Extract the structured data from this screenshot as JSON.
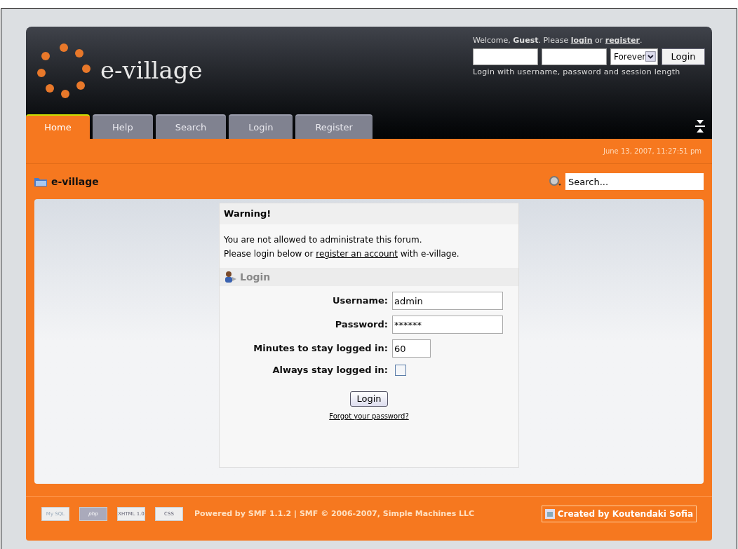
{
  "site_title": "e-village",
  "user_panel": {
    "welcome": [
      {
        "kind": "text",
        "text": "Welcome, **Guest**. Please"
      },
      {
        "kind": "link",
        "text": "login"
      },
      {
        "kind": "text",
        "text": "or"
      },
      {
        "kind": "link",
        "text": "register"
      },
      {
        "kind": "text",
        "text": "."
      }
    ],
    "session_length": "Forever",
    "button": "Login",
    "hint": "Login with username, password and session length"
  },
  "tabs": [
    {
      "label": "Home",
      "selected": true
    },
    {
      "label": "Help",
      "selected": false
    },
    {
      "label": "Search",
      "selected": false
    },
    {
      "label": "Login",
      "selected": false
    },
    {
      "label": "Register",
      "selected": false
    }
  ],
  "date": "June 13, 2007, 11:27:51 pm",
  "breadcrumb": "e-village",
  "search": {
    "placeholder": "Search..."
  },
  "warning": {
    "title": "Warning!",
    "line_1": "You are not allowed to administrate this forum.",
    "line_2": [
      {
        "kind": "text",
        "text": "Please login below or"
      },
      {
        "kind": "link",
        "text": "register an account"
      },
      {
        "kind": "text",
        "text": "with e-village."
      }
    ]
  },
  "login": {
    "title": "Login",
    "fields": [
      {
        "kind": "text",
        "label": "Username:",
        "value": "admin"
      },
      {
        "kind": "text",
        "label": "Password:",
        "value": "******"
      },
      {
        "kind": "number",
        "label": "Minutes to stay logged in:",
        "value": "60"
      },
      {
        "kind": "checkbox",
        "label": "Always stay logged in:",
        "checked": false
      }
    ],
    "button": "Login",
    "forgot": "Forgot your password?"
  },
  "footer": {
    "badges": [
      "My SQL",
      "php",
      "XHTML 1.0",
      "CSS"
    ],
    "powered": "Powered by SMF 1.1.2 | SMF © 2006-2007, Simple Machines LLC",
    "credit": "Created by Koutendaki Sofia"
  }
}
